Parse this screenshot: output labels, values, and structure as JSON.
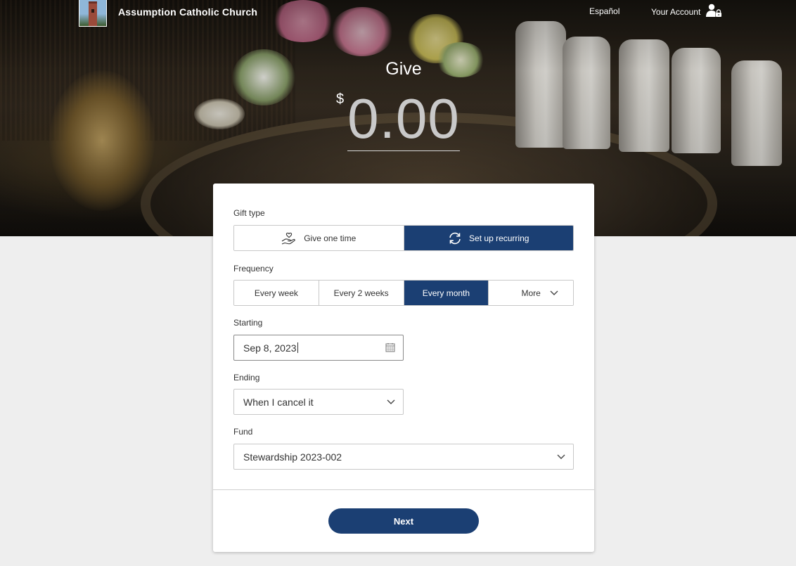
{
  "header": {
    "church_name": "Assumption Catholic Church",
    "language_link": "Español",
    "account_link": "Your Account"
  },
  "hero": {
    "title": "Give",
    "currency_symbol": "$",
    "amount_placeholder": "0.00"
  },
  "form": {
    "gift_type": {
      "label": "Gift type",
      "options": [
        {
          "label": "Give one time",
          "icon": "hand-heart-icon",
          "selected": false
        },
        {
          "label": "Set up recurring",
          "icon": "recurring-arrows-icon",
          "selected": true
        }
      ]
    },
    "frequency": {
      "label": "Frequency",
      "options": [
        {
          "label": "Every week",
          "selected": false
        },
        {
          "label": "Every 2 weeks",
          "selected": false
        },
        {
          "label": "Every month",
          "selected": true
        },
        {
          "label": "More",
          "selected": false
        }
      ]
    },
    "starting": {
      "label": "Starting",
      "value": "Sep 8, 2023"
    },
    "ending": {
      "label": "Ending",
      "value": "When I cancel it"
    },
    "fund": {
      "label": "Fund",
      "value": "Stewardship 2023-002"
    },
    "next_label": "Next"
  },
  "colors": {
    "primary": "#1b3f73",
    "page_bg": "#eeeeee",
    "amount_text": "#c9c9c9"
  }
}
